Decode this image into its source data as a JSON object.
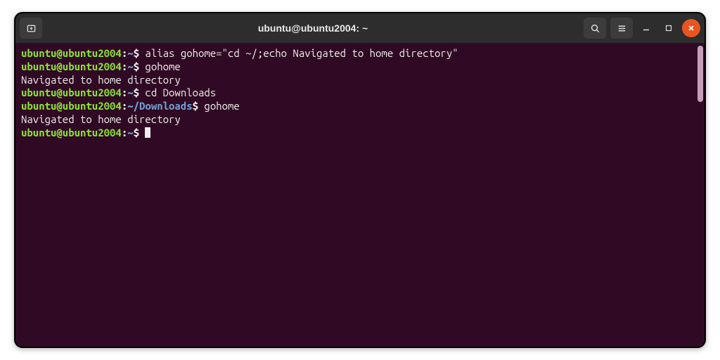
{
  "titlebar": {
    "title": "ubuntu@ubuntu2004: ~"
  },
  "prompt": {
    "userhost": "ubuntu@ubuntu2004",
    "path_home": "~",
    "path_downloads": "~/Downloads",
    "colon": ":",
    "symbol": "$"
  },
  "lines": {
    "cmd1": " alias gohome=\"cd ~/;echo Navigated to home directory\"",
    "cmd2": " gohome",
    "out1": "Navigated to home directory",
    "cmd3": " cd Downloads",
    "cmd4": " gohome",
    "out2": "Navigated to home directory",
    "cmd5": " "
  }
}
